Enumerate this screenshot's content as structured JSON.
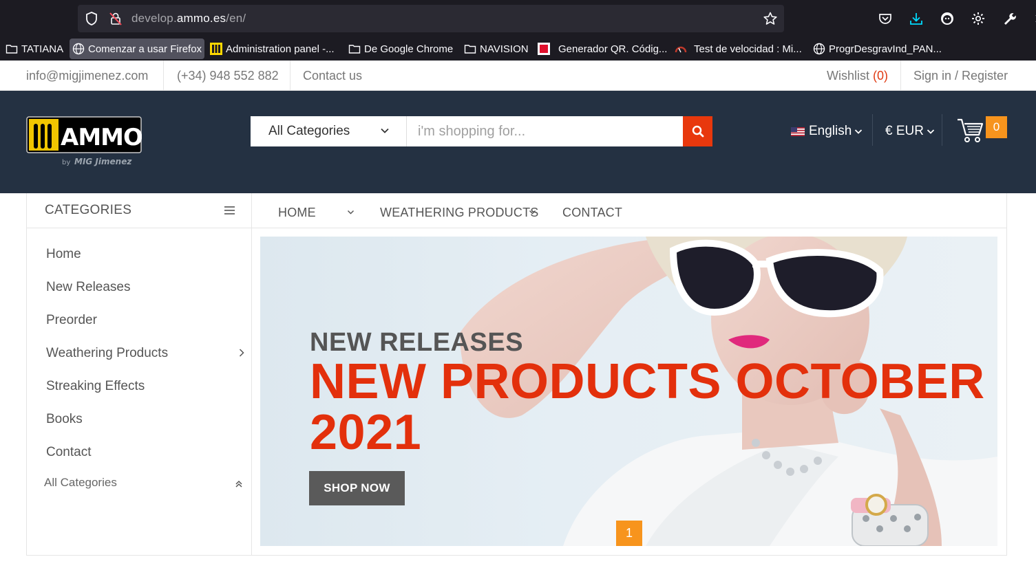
{
  "browser": {
    "url_prefix": "develop.",
    "url_domain": "ammo.es",
    "url_path": "/en/",
    "bookmarks": [
      {
        "label": "TATIANA",
        "icon": "folder-icon"
      },
      {
        "label": "Comenzar a usar Firefox",
        "icon": "globe-icon"
      },
      {
        "label": "Administration panel -...",
        "icon": "admin-panel-icon"
      },
      {
        "label": "De Google Chrome",
        "icon": "folder-icon"
      },
      {
        "label": "NAVISION",
        "icon": "folder-icon"
      },
      {
        "label": "Generador QR. Códig...",
        "icon": "qr-icon"
      },
      {
        "label": "Test de velocidad : Mi...",
        "icon": "speedometer-icon"
      },
      {
        "label": "ProgrDesgravInd_PAN...",
        "icon": "globe-icon"
      }
    ]
  },
  "topbar": {
    "email": "info@migjimenez.com",
    "phone": "(+34) 948 552 882",
    "contact": "Contact us",
    "wishlist_label": "Wishlist",
    "wishlist_count": "(0)",
    "signin": "Sign in / Register"
  },
  "header": {
    "category_select": "All Categories",
    "search_placeholder": "i'm shopping for...",
    "language": "English",
    "currency": "€ EUR",
    "cart_count": "0"
  },
  "sidebar": {
    "title": "CATEGORIES",
    "items": [
      "Home",
      "New Releases",
      "Preorder",
      "Weathering Products",
      "Streaking Effects",
      "Books",
      "Contact"
    ],
    "all_categories": "All Categories"
  },
  "nav": {
    "items": [
      "HOME",
      "WEATHERING PRODUCTS",
      "CONTACT"
    ]
  },
  "banner": {
    "subtitle": "NEW RELEASES",
    "title": "NEW PRODUCTS OCTOBER 2021",
    "button": "SHOP NOW",
    "slide": "1"
  },
  "colors": {
    "accent_red": "#e3300c",
    "accent_orange": "#f7941d",
    "header_bg": "#243142"
  }
}
